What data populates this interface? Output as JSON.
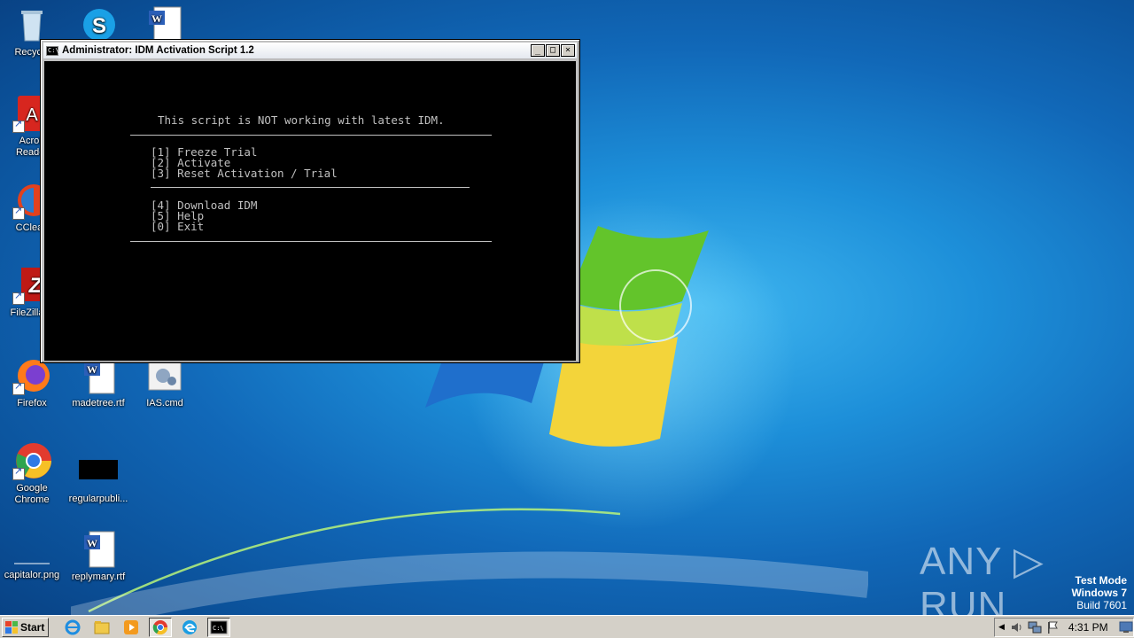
{
  "desktop": {
    "icons": [
      {
        "label": "Recycle",
        "icon": "recycle-bin-icon"
      },
      {
        "label": "",
        "icon": "skype-icon"
      },
      {
        "label": "",
        "icon": "word-document-icon"
      },
      {
        "label": "Acrob\nReader",
        "icon": "acrobat-reader-icon"
      },
      {
        "label": "CClean",
        "icon": "ccleaner-icon"
      },
      {
        "label": "FileZilla C",
        "icon": "filezilla-icon"
      },
      {
        "label": "Firefox",
        "icon": "firefox-icon"
      },
      {
        "label": "madetree.rtf",
        "icon": "word-document-icon"
      },
      {
        "label": "IAS.cmd",
        "icon": "cmd-script-icon"
      },
      {
        "label": "Google\nChrome",
        "icon": "chrome-icon"
      },
      {
        "label": "regularpubli...",
        "icon": "black-thumbnail-icon"
      },
      {
        "label": "capitalor.png",
        "icon": "image-file-icon"
      },
      {
        "label": "replymary.rtf",
        "icon": "word-document-icon"
      }
    ]
  },
  "window": {
    "title": "Administrator:  IDM Activation Script 1.2",
    "buttons": {
      "minimize": "_",
      "maximize": "□",
      "close": "×"
    },
    "console": {
      "header": "This script is NOT working with latest IDM.",
      "menu1": [
        "[1] Freeze Trial",
        "[2] Activate",
        "[3] Reset Activation / Trial"
      ],
      "menu2": [
        "[4] Download IDM",
        "[5] Help",
        "[0] Exit"
      ]
    }
  },
  "taskbar": {
    "start_label": "Start",
    "items": [
      "internet-explorer-icon",
      "file-explorer-icon",
      "media-player-icon",
      "chrome-icon",
      "edge-icon",
      "cmd-icon"
    ],
    "clock": "4:31 PM",
    "tray_icons": [
      "speaker-icon",
      "network-icon",
      "action-center-flag-icon",
      "show-desktop-icon"
    ]
  },
  "watermark": {
    "line1": "Test Mode",
    "line2": "Windows 7",
    "line3": "Build 7601",
    "brand": "ANY ▷ RUN"
  }
}
